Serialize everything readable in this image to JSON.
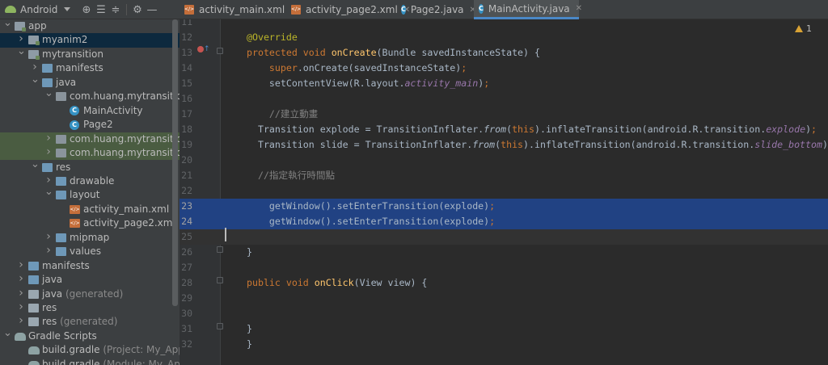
{
  "project_panel": {
    "view_selector": "Android",
    "toolbar_icons": [
      "target-icon",
      "expand-all-icon",
      "collapse-all-icon",
      "gear-icon",
      "minimize-icon"
    ]
  },
  "tree": [
    {
      "label": "app",
      "suffix": "",
      "icon": "module",
      "arrow": "open"
    },
    {
      "label": "myanim2",
      "suffix": "",
      "icon": "module",
      "arrow": "closed"
    },
    {
      "label": "mytransition",
      "suffix": "",
      "icon": "module",
      "arrow": "open"
    },
    {
      "label": "manifests",
      "suffix": "",
      "icon": "folder",
      "arrow": "closed"
    },
    {
      "label": "java",
      "suffix": "",
      "icon": "folder",
      "arrow": "open"
    },
    {
      "label": "com.huang.mytransition",
      "suffix": "",
      "icon": "package",
      "arrow": "open"
    },
    {
      "label": "MainActivity",
      "suffix": "",
      "icon": "class",
      "arrow": "none"
    },
    {
      "label": "Page2",
      "suffix": "",
      "icon": "class",
      "arrow": "none"
    },
    {
      "label": "com.huang.mytransition",
      "suffix": " (",
      "icon": "package",
      "arrow": "closed"
    },
    {
      "label": "com.huang.mytransition",
      "suffix": " (",
      "icon": "package",
      "arrow": "closed"
    },
    {
      "label": "res",
      "suffix": "",
      "icon": "folder",
      "arrow": "open"
    },
    {
      "label": "drawable",
      "suffix": "",
      "icon": "folder",
      "arrow": "closed"
    },
    {
      "label": "layout",
      "suffix": "",
      "icon": "folder",
      "arrow": "open"
    },
    {
      "label": "activity_main.xml",
      "suffix": "",
      "icon": "xml",
      "arrow": "none"
    },
    {
      "label": "activity_page2.xml",
      "suffix": "",
      "icon": "xml",
      "arrow": "none"
    },
    {
      "label": "mipmap",
      "suffix": "",
      "icon": "folder",
      "arrow": "closed"
    },
    {
      "label": "values",
      "suffix": "",
      "icon": "folder",
      "arrow": "closed"
    },
    {
      "label": "manifests",
      "suffix": "",
      "icon": "folder",
      "arrow": "closed"
    },
    {
      "label": "java",
      "suffix": "",
      "icon": "folder",
      "arrow": "closed"
    },
    {
      "label": "java",
      "suffix": " (generated)",
      "icon": "folder-gen",
      "arrow": "closed"
    },
    {
      "label": "res",
      "suffix": "",
      "icon": "folder-gen",
      "arrow": "closed"
    },
    {
      "label": "res",
      "suffix": " (generated)",
      "icon": "folder-gen",
      "arrow": "closed"
    },
    {
      "label": "Gradle Scripts",
      "suffix": "",
      "icon": "gradle",
      "arrow": "open"
    },
    {
      "label": "build.gradle",
      "suffix": " (Project: My_Applica",
      "icon": "gradle",
      "arrow": "none"
    },
    {
      "label": "build.gradle",
      "suffix": " (Module: My_Appli",
      "icon": "gradle",
      "arrow": "none"
    }
  ],
  "tabs": [
    {
      "label": "activity_main.xml",
      "type": "xml"
    },
    {
      "label": "activity_page2.xml",
      "type": "xml"
    },
    {
      "label": "Page2.java",
      "type": "class"
    },
    {
      "label": "MainActivity.java",
      "type": "class"
    }
  ],
  "editor": {
    "warnings_count": "1",
    "lines": [
      {
        "n": "11",
        "html": ""
      },
      {
        "n": "12",
        "html": "<span class=\"ann\">@Override</span>"
      },
      {
        "n": "13",
        "html": "<span class=\"kw\">protected void </span><span class=\"fn\">onCreate</span>(Bundle savedInstanceState) {"
      },
      {
        "n": "14",
        "html": "    <span class=\"kw\">super</span>.onCreate(savedInstanceState)<span class=\"kw\">;</span>"
      },
      {
        "n": "15",
        "html": "    setContentView(R.layout.<span class=\"it\">activity_main</span>)<span class=\"kw\">;</span>"
      },
      {
        "n": "16",
        "html": ""
      },
      {
        "n": "17",
        "html": "    <span class=\"cmt\">//建立動畫</span>"
      },
      {
        "n": "18",
        "html": "  Transition explode = TransitionInflater.<span class=\"itw\">from</span>(<span class=\"kw\">this</span>).inflateTransition(android.R.transition.<span class=\"it\">explode</span>)<span class=\"kw\">;</span>"
      },
      {
        "n": "19",
        "html": "  Transition slide = TransitionInflater.<span class=\"itw\">from</span>(<span class=\"kw\">this</span>).inflateTransition(android.R.transition.<span class=\"it\">slide_bottom</span>)<span class=\"kw\">;</span>"
      },
      {
        "n": "20",
        "html": ""
      },
      {
        "n": "21",
        "html": "  <span class=\"cmt\">//指定執行時間點</span>"
      },
      {
        "n": "22",
        "html": ""
      },
      {
        "n": "23",
        "html": "    getWindow().setEnterTransition(explode)<span class=\"kw\">;</span>"
      },
      {
        "n": "24",
        "html": "    getWindow().setEnterTransition(explode)<span class=\"kw\">;</span>"
      },
      {
        "n": "25",
        "html": ""
      },
      {
        "n": "26",
        "html": "}"
      },
      {
        "n": "27",
        "html": ""
      },
      {
        "n": "28",
        "html": "<span class=\"kw\">public void </span><span class=\"fn\">onClick</span>(View view) {"
      },
      {
        "n": "29",
        "html": ""
      },
      {
        "n": "30",
        "html": ""
      },
      {
        "n": "31",
        "html": "}"
      },
      {
        "n": "32",
        "html": "}"
      }
    ]
  },
  "colors": {
    "selection": "#214283",
    "panel_bg": "#3c3f41",
    "editor_bg": "#2b2b2b",
    "keyword": "#cc7832",
    "tab_active_underline": "#4a88c7"
  }
}
